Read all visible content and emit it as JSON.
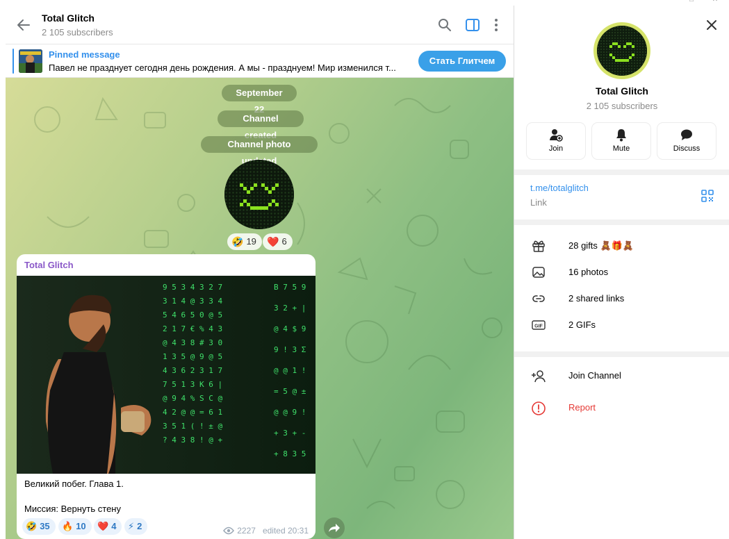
{
  "chat": {
    "title": "Total Glitch",
    "subscribers": "2 105 subscribers"
  },
  "pinned": {
    "title": "Pinned message",
    "text": "Павел не празднует сегодня день рождения. А мы - празднуем!  Мир изменился т...",
    "button": "Стать Глитчем"
  },
  "service": {
    "date": "September 22",
    "created": "Channel created",
    "photo_updated": "Channel photo updated"
  },
  "photo_reactions": [
    {
      "emoji": "🤣",
      "count": "19"
    },
    {
      "emoji": "❤️",
      "count": "6"
    }
  ],
  "message": {
    "author": "Total Glitch",
    "line1": "Великий побег. Глава 1.",
    "line2": "Миссия: Вернуть стену",
    "views": "2227",
    "edited": "edited 20:31",
    "reactions": [
      {
        "emoji": "🤣",
        "count": "35"
      },
      {
        "emoji": "🔥",
        "count": "10"
      },
      {
        "emoji": "❤️",
        "count": "4"
      },
      {
        "emoji": "⚡",
        "count": "2"
      }
    ]
  },
  "panel": {
    "title": "Total Glitch",
    "subscribers": "2 105 subscribers",
    "actions": {
      "join": "Join",
      "mute": "Mute",
      "discuss": "Discuss"
    },
    "link": "t.me/totalglitch",
    "link_label": "Link",
    "gifts_text": "28 gifts",
    "gifts_emojis": "🧸🎁🧸",
    "photos": "16 photos",
    "shared_links": "2 shared links",
    "gifs": "2 GIFs",
    "gif_badge": "GIF",
    "join_channel": "Join Channel",
    "report": "Report"
  },
  "colors": {
    "accent": "#3390ec",
    "author": "#8a58c8",
    "report": "#e53935",
    "avatar_ring": "#d5e36a"
  }
}
